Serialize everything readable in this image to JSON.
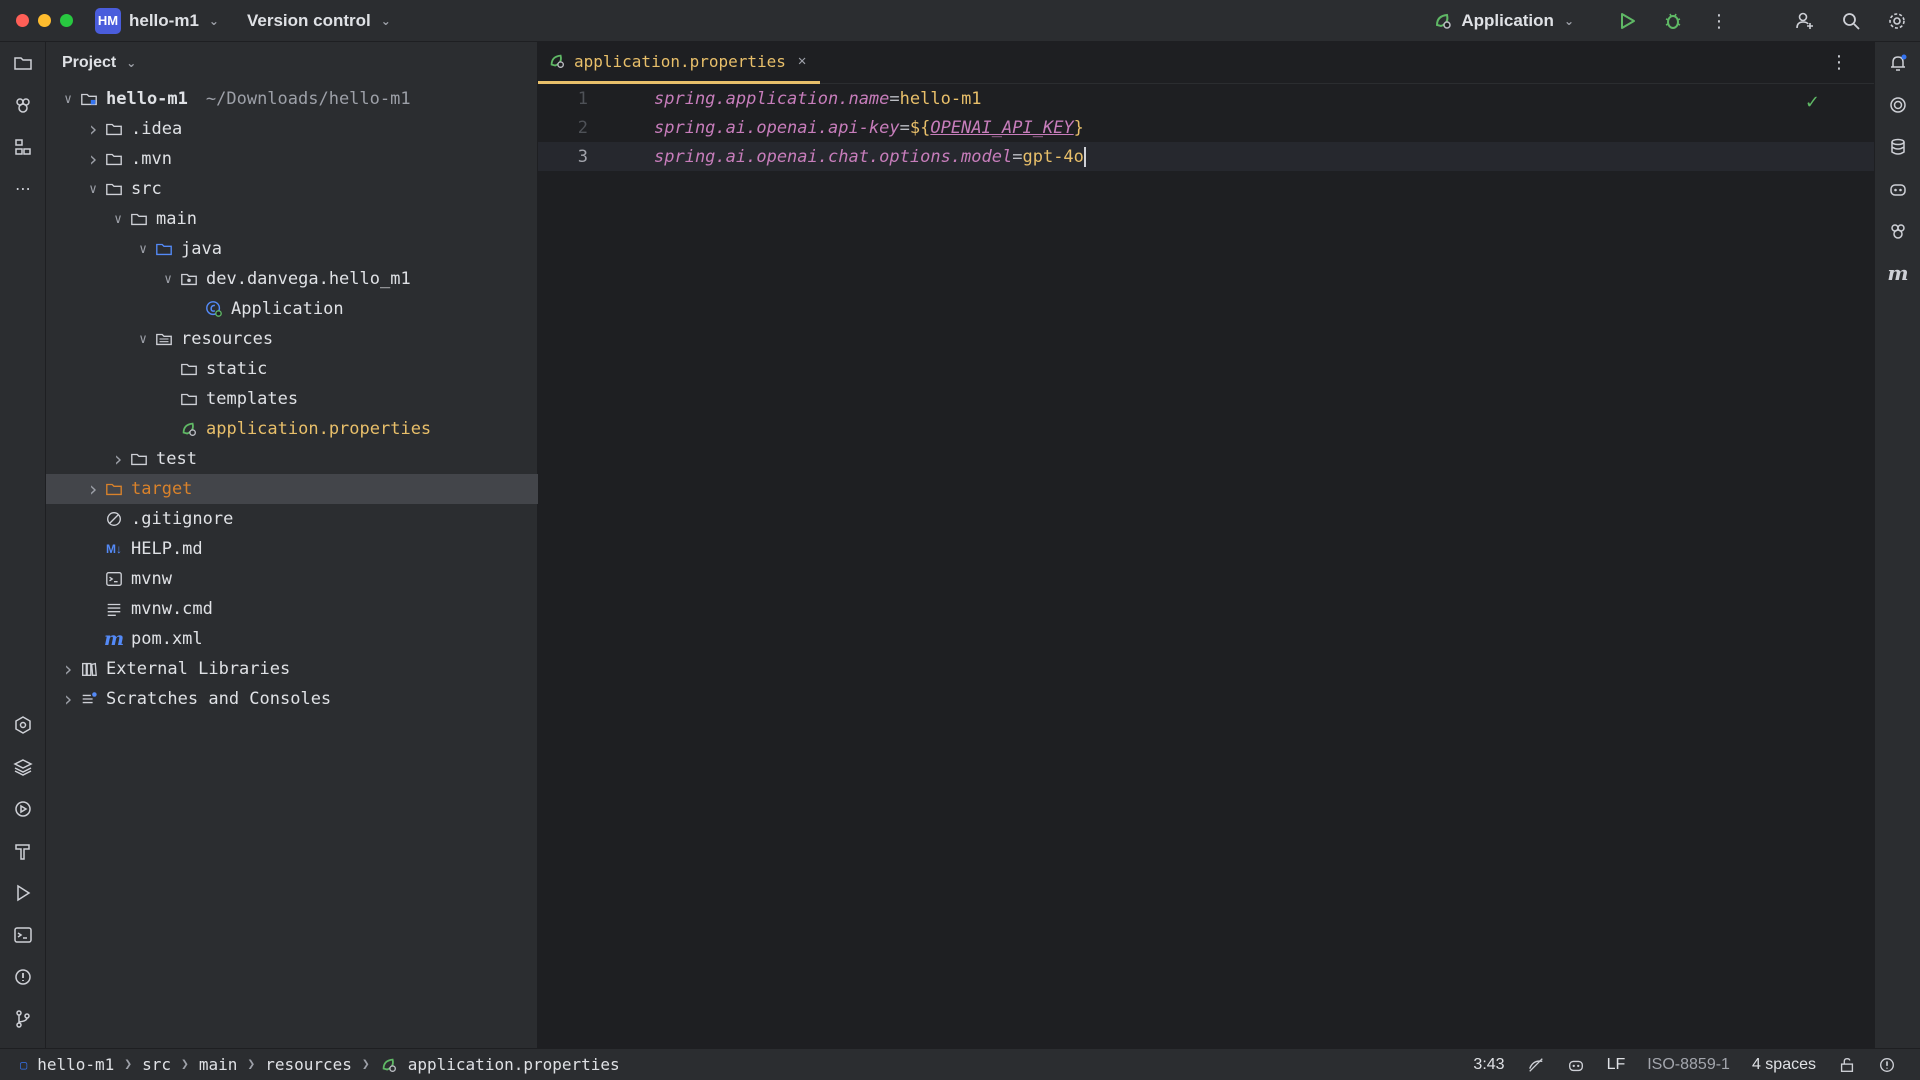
{
  "titlebar": {
    "project_badge": "HM",
    "project_name": "hello-m1",
    "vcs_label": "Version control",
    "run_config": "Application"
  },
  "project_panel": {
    "title": "Project",
    "tree": [
      {
        "label": "hello-m1",
        "hint": "~/Downloads/hello-m1",
        "icon": "module-folder-icon",
        "expanded": true
      },
      {
        "label": ".idea",
        "icon": "folder-icon",
        "expanded": false
      },
      {
        "label": ".mvn",
        "icon": "folder-icon",
        "expanded": false
      },
      {
        "label": "src",
        "icon": "folder-icon",
        "expanded": true
      },
      {
        "label": "main",
        "icon": "folder-icon",
        "expanded": true
      },
      {
        "label": "java",
        "icon": "source-folder-icon",
        "expanded": true
      },
      {
        "label": "dev.danvega.hello_m1",
        "icon": "package-icon",
        "expanded": true
      },
      {
        "label": "Application",
        "icon": "spring-class-icon"
      },
      {
        "label": "resources",
        "icon": "resources-folder-icon",
        "expanded": true
      },
      {
        "label": "static",
        "icon": "folder-icon"
      },
      {
        "label": "templates",
        "icon": "folder-icon"
      },
      {
        "label": "application.properties",
        "icon": "spring-properties-icon"
      },
      {
        "label": "test",
        "icon": "folder-icon",
        "expanded": false
      },
      {
        "label": "target",
        "icon": "excluded-folder-icon",
        "expanded": false
      },
      {
        "label": ".gitignore",
        "icon": "ignore-file-icon"
      },
      {
        "label": "HELP.md",
        "icon": "markdown-icon"
      },
      {
        "label": "mvnw",
        "icon": "shell-script-icon"
      },
      {
        "label": "mvnw.cmd",
        "icon": "text-file-icon"
      },
      {
        "label": "pom.xml",
        "icon": "maven-icon"
      },
      {
        "label": "External Libraries",
        "icon": "libraries-icon",
        "expanded": false
      },
      {
        "label": "Scratches and Consoles",
        "icon": "scratches-icon",
        "expanded": false
      }
    ]
  },
  "editor": {
    "tab_label": "application.properties",
    "lines": [
      {
        "num": "1",
        "key": "spring.application.name",
        "eq": "=",
        "value": "hello-m1"
      },
      {
        "num": "2",
        "key": "spring.ai.openai.api-key",
        "eq": "=",
        "value_prefix": "${",
        "value_var": "OPENAI_API_KEY",
        "value_suffix": "}"
      },
      {
        "num": "3",
        "key": "spring.ai.openai.chat.options.model",
        "eq": "=",
        "value": "gpt-4o"
      }
    ]
  },
  "statusbar": {
    "crumbs": [
      "hello-m1",
      "src",
      "main",
      "resources",
      "application.properties"
    ],
    "position": "3:43",
    "line_ending": "LF",
    "encoding": "ISO-8859-1",
    "indent": "4 spaces"
  },
  "colors": {
    "accent": "#e8bf6a",
    "key": "#c77dbb",
    "background": "#1e1f22",
    "panel": "#2b2d30"
  }
}
